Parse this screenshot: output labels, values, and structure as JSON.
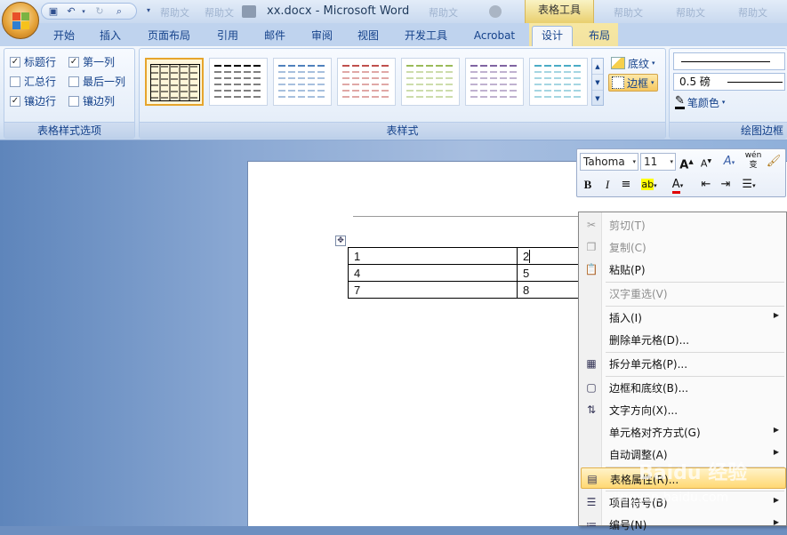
{
  "window": {
    "title": "xx.docx - Microsoft Word",
    "context_tab_title": "表格工具",
    "blurred_left": [
      "帮助文",
      "帮助文",
      "帮助文"
    ],
    "blurred_right": [
      "帮助文",
      "帮助文",
      "帮助文"
    ]
  },
  "tabs": [
    {
      "label": "开始"
    },
    {
      "label": "插入"
    },
    {
      "label": "页面布局"
    },
    {
      "label": "引用"
    },
    {
      "label": "邮件"
    },
    {
      "label": "审阅"
    },
    {
      "label": "视图"
    },
    {
      "label": "开发工具"
    },
    {
      "label": "Acrobat"
    },
    {
      "label": "设计"
    },
    {
      "label": "布局"
    }
  ],
  "active_tab": "设计",
  "style_options": {
    "label": "表格样式选项",
    "items": [
      {
        "label": "标题行",
        "checked": true
      },
      {
        "label": "第一列",
        "checked": true
      },
      {
        "label": "汇总行",
        "checked": false
      },
      {
        "label": "最后一列",
        "checked": false
      },
      {
        "label": "镶边行",
        "checked": true
      },
      {
        "label": "镶边列",
        "checked": false
      }
    ]
  },
  "table_styles": {
    "label": "表样式",
    "swatch_colors": [
      "#000000",
      "#000000",
      "#4f81bd",
      "#c0504d",
      "#9bbb59",
      "#8064a2",
      "#4bacc6"
    ],
    "shading_label": "底纹",
    "borders_label": "边框"
  },
  "draw_borders": {
    "label": "绘图边框",
    "weight": "0.5 磅",
    "pen_color_label": "笔颜色"
  },
  "mini_toolbar": {
    "font": "Tahoma",
    "size": "11",
    "bold": "B",
    "italic": "I",
    "wen_label": "wén\n变"
  },
  "document": {
    "table": [
      [
        "1",
        "2"
      ],
      [
        "4",
        "5"
      ],
      [
        "7",
        "8"
      ]
    ]
  },
  "context_menu": {
    "items": [
      {
        "label": "剪切(T)",
        "disabled": true,
        "icon": "scissors-icon"
      },
      {
        "label": "复制(C)",
        "disabled": true,
        "icon": "copy-icon"
      },
      {
        "label": "粘贴(P)",
        "disabled": false,
        "icon": "paste-icon"
      },
      {
        "label": "汉字重选(V)",
        "disabled": true,
        "icon": ""
      },
      {
        "label": "插入(I)",
        "disabled": false,
        "icon": "",
        "submenu": true
      },
      {
        "label": "删除单元格(D)...",
        "disabled": false,
        "icon": ""
      },
      {
        "label": "拆分单元格(P)...",
        "disabled": false,
        "icon": "split-cells-icon"
      },
      {
        "label": "边框和底纹(B)...",
        "disabled": false,
        "icon": "borders-icon"
      },
      {
        "label": "文字方向(X)...",
        "disabled": false,
        "icon": "text-direction-icon"
      },
      {
        "label": "单元格对齐方式(G)",
        "disabled": false,
        "icon": "",
        "submenu": true
      },
      {
        "label": "自动调整(A)",
        "disabled": false,
        "icon": "",
        "submenu": true
      },
      {
        "label": "表格属性(R)...",
        "disabled": false,
        "icon": "table-properties-icon",
        "highlighted": true
      },
      {
        "label": "项目符号(B)",
        "disabled": false,
        "icon": "bullets-icon",
        "submenu": true
      },
      {
        "label": "编号(N)",
        "disabled": false,
        "icon": "numbering-icon",
        "submenu": true
      }
    ]
  },
  "watermark": {
    "text": "Baidu 经验",
    "url": "jingyan.baidu.com"
  }
}
